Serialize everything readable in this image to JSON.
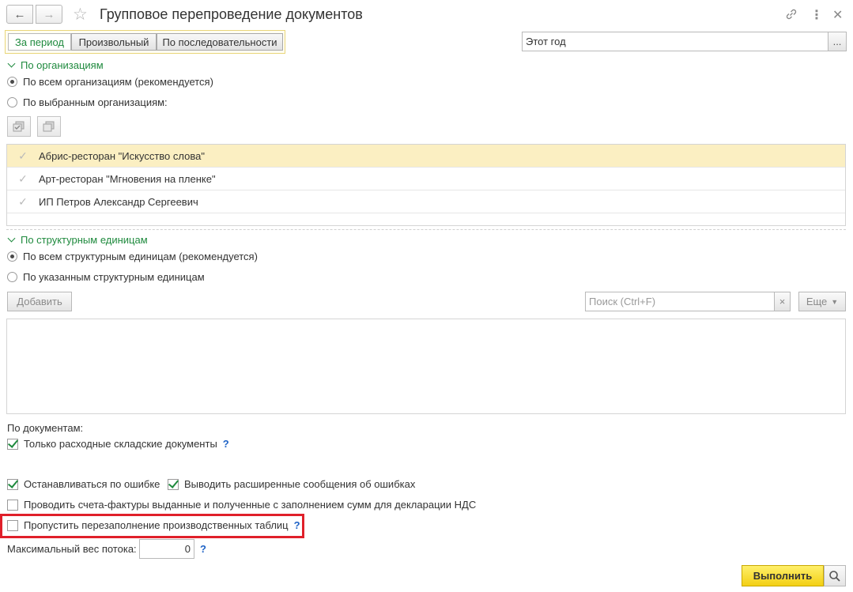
{
  "window": {
    "title": "Групповое перепроведение документов"
  },
  "period_tabs": [
    {
      "label": "За период",
      "active": true
    },
    {
      "label": "Произвольный",
      "active": false
    },
    {
      "label": "По последовательности",
      "active": false
    }
  ],
  "period_field": {
    "value": "Этот год",
    "choose_label": "..."
  },
  "organizations": {
    "section_title": "По организациям",
    "option_all": "По всем организациям (рекомендуется)",
    "option_selected": "По выбранным организациям:",
    "selected_option": "all",
    "rows": [
      {
        "name": "Абрис-ресторан \"Искусство слова\"",
        "selected": true
      },
      {
        "name": "Арт-ресторан \"Мгновения на пленке\"",
        "selected": false
      },
      {
        "name": "ИП Петров Александр Сергеевич",
        "selected": false
      }
    ]
  },
  "units": {
    "section_title": "По структурным единицам",
    "option_all": "По всем структурным единицам (рекомендуется)",
    "option_selected": "По указанным структурным единицам",
    "selected_option": "all",
    "add_label": "Добавить",
    "search_placeholder": "Поиск (Ctrl+F)",
    "search_clear": "×",
    "more_label": "Еще"
  },
  "documents": {
    "label": "По документам:",
    "only_outgoing": {
      "label": "Только расходные складские документы",
      "checked": true,
      "help": "?"
    }
  },
  "options": {
    "stop_on_error": {
      "label": "Останавливаться по ошибке",
      "checked": true
    },
    "extended_messages": {
      "label": "Выводить расширенные сообщения об ошибках",
      "checked": true
    },
    "invoices": {
      "label": "Проводить счета-фактуры выданные и полученные с заполнением сумм для декларации НДС",
      "checked": false
    },
    "skip_refill": {
      "label": "Пропустить перезаполнение производственных таблиц",
      "checked": false,
      "help": "?"
    }
  },
  "thread": {
    "label": "Максимальный вес потока:",
    "value": "0",
    "help": "?"
  },
  "footer": {
    "run_label": "Выполнить"
  },
  "colors": {
    "accent_green": "#1f8a3e",
    "selected_row": "#fbefc2",
    "run_button": "#f3cf14",
    "highlight_red": "#e0202a"
  }
}
